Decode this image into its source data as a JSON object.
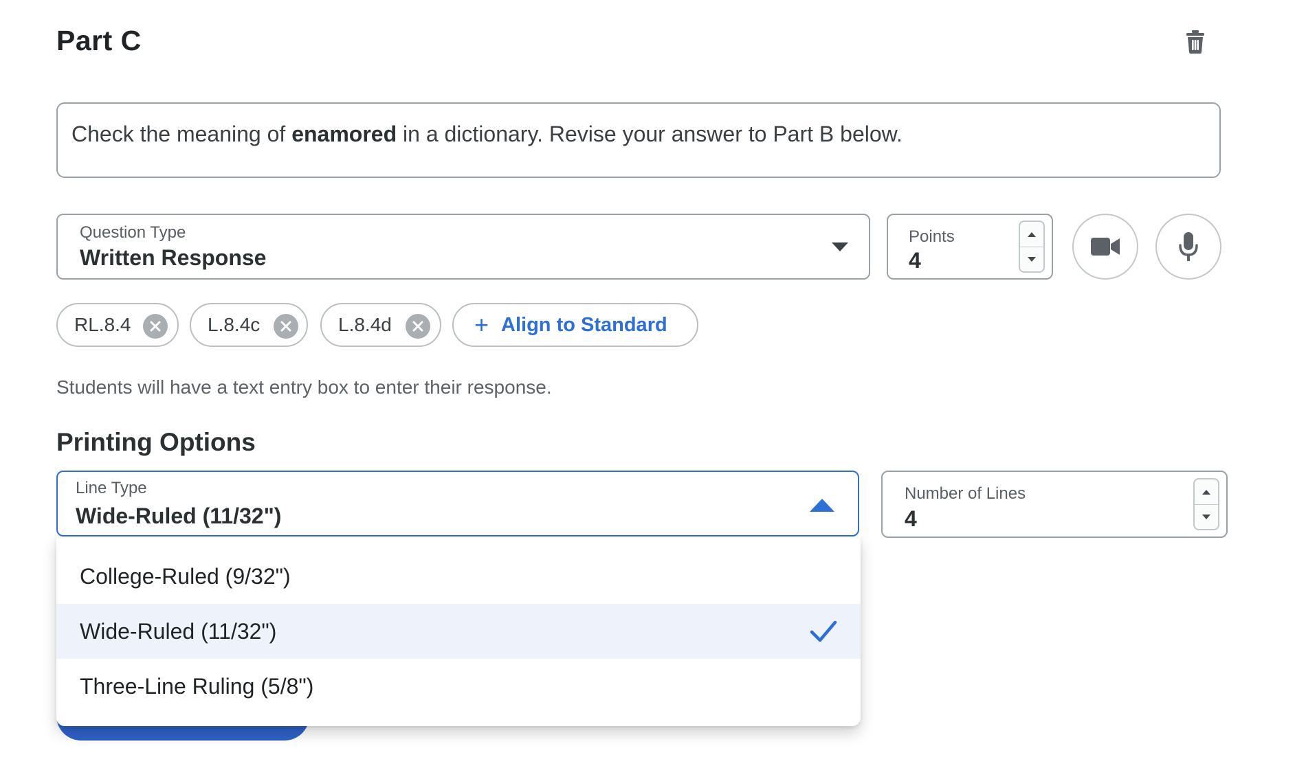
{
  "part": {
    "title": "Part C"
  },
  "prompt": {
    "before": "Check the meaning of ",
    "bold": "enamored",
    "after": " in a dictionary. Revise your answer to Part B below."
  },
  "question_type": {
    "label": "Question Type",
    "value": "Written Response"
  },
  "points": {
    "label": "Points",
    "value": "4"
  },
  "standards": {
    "chips": [
      "RL.8.4",
      "L.8.4c",
      "L.8.4d"
    ],
    "align_label": "Align to Standard"
  },
  "help_text": "Students will have a text entry box to enter their response.",
  "printing": {
    "title": "Printing Options",
    "line_type": {
      "label": "Line Type",
      "value": "Wide-Ruled (11/32\")",
      "options": [
        "College-Ruled (9/32\")",
        "Wide-Ruled (11/32\")",
        "Three-Line Ruling (5/8\")"
      ],
      "selected_index": 1
    },
    "number_of_lines": {
      "label": "Number of Lines",
      "value": "4"
    }
  },
  "colors": {
    "accent": "#2e6fd6",
    "selected_bg": "#edf2fb",
    "border": "#9aa1a6"
  },
  "icons": [
    "trash-icon",
    "chevron-down-icon",
    "video-camera-icon",
    "microphone-icon",
    "close-circle-icon",
    "plus-icon",
    "chevron-up-icon",
    "checkmark-icon"
  ]
}
